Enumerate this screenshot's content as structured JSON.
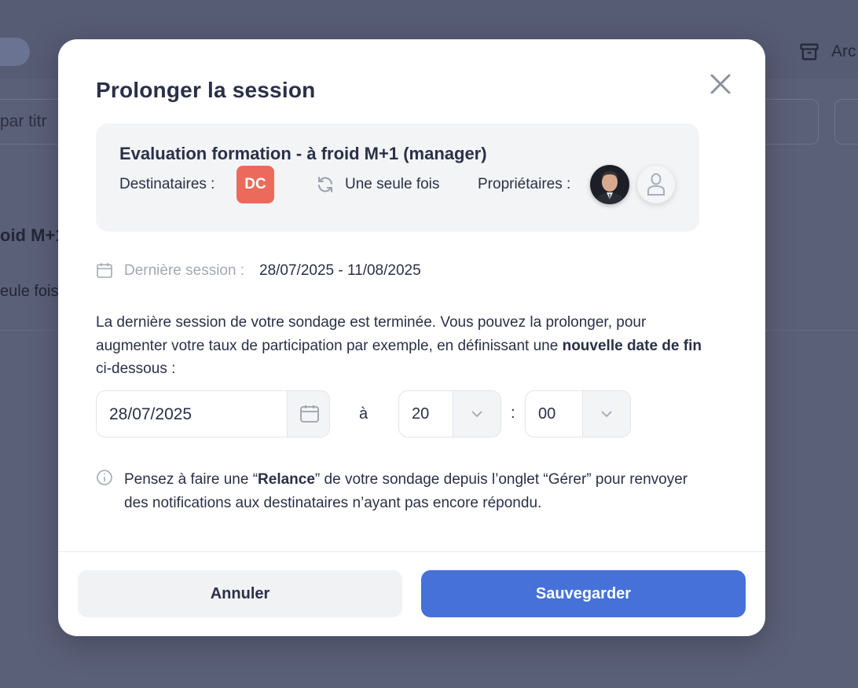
{
  "background": {
    "archive_label": "Arc",
    "search_placeholder": "par titr",
    "row_title": "oid M+1",
    "row_subtitle": "eule fois"
  },
  "modal": {
    "title": "Prolonger la session",
    "survey": {
      "title": "Evaluation formation - à froid M+1 (manager)",
      "recipients_label": "Destinataires :",
      "recipient_badge": "DC",
      "recipient_badge_color": "#ec6a5c",
      "recurrence_label": "Une seule fois",
      "owners_label": "Propriétaires :"
    },
    "last_session": {
      "label": "Dernière session :",
      "value": "28/07/2025 - 11/08/2025"
    },
    "description": {
      "part1": "La dernière session de votre sondage est terminée. Vous pouvez la prolonger, pour augmenter votre taux de participation par exemple, en définissant une ",
      "bold": "nouvelle date de fin",
      "part2": " ci-dessous :"
    },
    "form": {
      "date_value": "28/07/2025",
      "at_label": "à",
      "hour_value": "20",
      "colon": ":",
      "minute_value": "00"
    },
    "info": {
      "part1": "Pensez à faire une “",
      "bold": "Relance",
      "part2": "” de votre sondage depuis l’onglet “Gérer” pour renvoyer des notifications aux destinataires n’ayant pas encore répondu."
    },
    "footer": {
      "cancel_label": "Annuler",
      "save_label": "Sauvegarder"
    }
  },
  "colors": {
    "primary": "#4571d8",
    "text": "#2a3047",
    "muted": "#a3a8b4",
    "overlay": "#5b6079"
  }
}
